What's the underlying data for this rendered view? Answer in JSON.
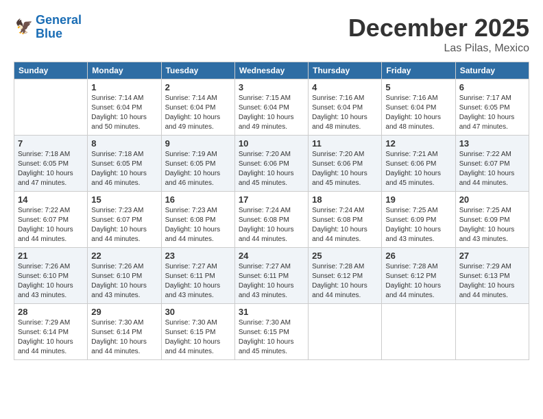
{
  "header": {
    "logo_line1": "General",
    "logo_line2": "Blue",
    "month": "December 2025",
    "location": "Las Pilas, Mexico"
  },
  "days_of_week": [
    "Sunday",
    "Monday",
    "Tuesday",
    "Wednesday",
    "Thursday",
    "Friday",
    "Saturday"
  ],
  "weeks": [
    [
      {
        "day": "",
        "info": ""
      },
      {
        "day": "1",
        "info": "Sunrise: 7:14 AM\nSunset: 6:04 PM\nDaylight: 10 hours\nand 50 minutes."
      },
      {
        "day": "2",
        "info": "Sunrise: 7:14 AM\nSunset: 6:04 PM\nDaylight: 10 hours\nand 49 minutes."
      },
      {
        "day": "3",
        "info": "Sunrise: 7:15 AM\nSunset: 6:04 PM\nDaylight: 10 hours\nand 49 minutes."
      },
      {
        "day": "4",
        "info": "Sunrise: 7:16 AM\nSunset: 6:04 PM\nDaylight: 10 hours\nand 48 minutes."
      },
      {
        "day": "5",
        "info": "Sunrise: 7:16 AM\nSunset: 6:04 PM\nDaylight: 10 hours\nand 48 minutes."
      },
      {
        "day": "6",
        "info": "Sunrise: 7:17 AM\nSunset: 6:05 PM\nDaylight: 10 hours\nand 47 minutes."
      }
    ],
    [
      {
        "day": "7",
        "info": "Sunrise: 7:18 AM\nSunset: 6:05 PM\nDaylight: 10 hours\nand 47 minutes."
      },
      {
        "day": "8",
        "info": "Sunrise: 7:18 AM\nSunset: 6:05 PM\nDaylight: 10 hours\nand 46 minutes."
      },
      {
        "day": "9",
        "info": "Sunrise: 7:19 AM\nSunset: 6:05 PM\nDaylight: 10 hours\nand 46 minutes."
      },
      {
        "day": "10",
        "info": "Sunrise: 7:20 AM\nSunset: 6:06 PM\nDaylight: 10 hours\nand 45 minutes."
      },
      {
        "day": "11",
        "info": "Sunrise: 7:20 AM\nSunset: 6:06 PM\nDaylight: 10 hours\nand 45 minutes."
      },
      {
        "day": "12",
        "info": "Sunrise: 7:21 AM\nSunset: 6:06 PM\nDaylight: 10 hours\nand 45 minutes."
      },
      {
        "day": "13",
        "info": "Sunrise: 7:22 AM\nSunset: 6:07 PM\nDaylight: 10 hours\nand 44 minutes."
      }
    ],
    [
      {
        "day": "14",
        "info": "Sunrise: 7:22 AM\nSunset: 6:07 PM\nDaylight: 10 hours\nand 44 minutes."
      },
      {
        "day": "15",
        "info": "Sunrise: 7:23 AM\nSunset: 6:07 PM\nDaylight: 10 hours\nand 44 minutes."
      },
      {
        "day": "16",
        "info": "Sunrise: 7:23 AM\nSunset: 6:08 PM\nDaylight: 10 hours\nand 44 minutes."
      },
      {
        "day": "17",
        "info": "Sunrise: 7:24 AM\nSunset: 6:08 PM\nDaylight: 10 hours\nand 44 minutes."
      },
      {
        "day": "18",
        "info": "Sunrise: 7:24 AM\nSunset: 6:08 PM\nDaylight: 10 hours\nand 44 minutes."
      },
      {
        "day": "19",
        "info": "Sunrise: 7:25 AM\nSunset: 6:09 PM\nDaylight: 10 hours\nand 43 minutes."
      },
      {
        "day": "20",
        "info": "Sunrise: 7:25 AM\nSunset: 6:09 PM\nDaylight: 10 hours\nand 43 minutes."
      }
    ],
    [
      {
        "day": "21",
        "info": "Sunrise: 7:26 AM\nSunset: 6:10 PM\nDaylight: 10 hours\nand 43 minutes."
      },
      {
        "day": "22",
        "info": "Sunrise: 7:26 AM\nSunset: 6:10 PM\nDaylight: 10 hours\nand 43 minutes."
      },
      {
        "day": "23",
        "info": "Sunrise: 7:27 AM\nSunset: 6:11 PM\nDaylight: 10 hours\nand 43 minutes."
      },
      {
        "day": "24",
        "info": "Sunrise: 7:27 AM\nSunset: 6:11 PM\nDaylight: 10 hours\nand 43 minutes."
      },
      {
        "day": "25",
        "info": "Sunrise: 7:28 AM\nSunset: 6:12 PM\nDaylight: 10 hours\nand 44 minutes."
      },
      {
        "day": "26",
        "info": "Sunrise: 7:28 AM\nSunset: 6:12 PM\nDaylight: 10 hours\nand 44 minutes."
      },
      {
        "day": "27",
        "info": "Sunrise: 7:29 AM\nSunset: 6:13 PM\nDaylight: 10 hours\nand 44 minutes."
      }
    ],
    [
      {
        "day": "28",
        "info": "Sunrise: 7:29 AM\nSunset: 6:14 PM\nDaylight: 10 hours\nand 44 minutes."
      },
      {
        "day": "29",
        "info": "Sunrise: 7:30 AM\nSunset: 6:14 PM\nDaylight: 10 hours\nand 44 minutes."
      },
      {
        "day": "30",
        "info": "Sunrise: 7:30 AM\nSunset: 6:15 PM\nDaylight: 10 hours\nand 44 minutes."
      },
      {
        "day": "31",
        "info": "Sunrise: 7:30 AM\nSunset: 6:15 PM\nDaylight: 10 hours\nand 45 minutes."
      },
      {
        "day": "",
        "info": ""
      },
      {
        "day": "",
        "info": ""
      },
      {
        "day": "",
        "info": ""
      }
    ]
  ]
}
